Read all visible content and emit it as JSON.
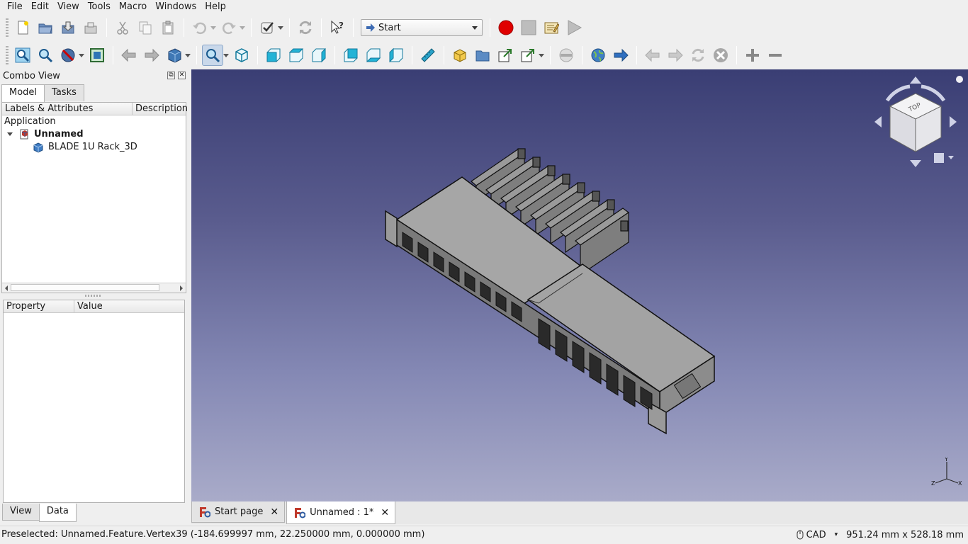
{
  "menu": [
    "File",
    "Edit",
    "View",
    "Tools",
    "Macro",
    "Windows",
    "Help"
  ],
  "toolbar": {
    "workbench": "Start"
  },
  "combo": {
    "title": "Combo View",
    "tabs": [
      "Model",
      "Tasks"
    ],
    "tree_headers": [
      "Labels & Attributes",
      "Description"
    ],
    "application_label": "Application",
    "document_name": "Unnamed",
    "object_name": "BLADE 1U Rack_3D",
    "prop_headers": [
      "Property",
      "Value"
    ],
    "bottom_tabs": [
      "View",
      "Data"
    ]
  },
  "doc_tabs": [
    {
      "label": "Start page"
    },
    {
      "label": "Unnamed : 1*"
    }
  ],
  "status": {
    "message": "Preselected: Unnamed.Feature.Vertex39 (-184.699997 mm, 22.250000 mm, 0.000000 mm)",
    "nav_style": "CAD",
    "dimensions": "951.24 mm x 528.18 mm"
  },
  "axis": {
    "x": "X",
    "y": "Y",
    "z": "Z"
  },
  "colors": {
    "view_top": "#3a3e74",
    "view_bottom": "#a9abc9",
    "model_face": "#a0a0a0",
    "record": "#e00000"
  },
  "icons": [
    "new-file-icon",
    "open-icon",
    "save-icon",
    "save-as-icon",
    "cut-icon",
    "copy-icon",
    "paste-icon",
    "undo-icon",
    "redo-icon",
    "refresh-icon",
    "whats-this-icon",
    "record-macro-icon",
    "stop-macro-icon",
    "edit-macro-icon",
    "run-macro-icon"
  ]
}
